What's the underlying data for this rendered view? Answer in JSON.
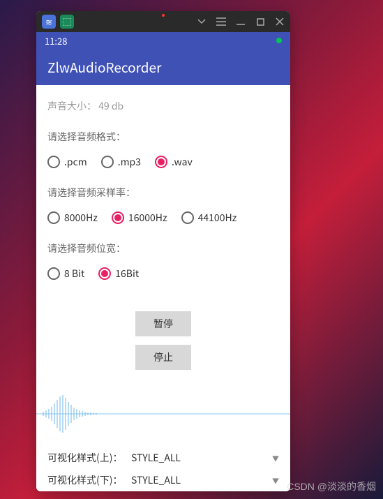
{
  "titlebar": {
    "icon1": "≋",
    "icon2": "⬚"
  },
  "statusbar": {
    "time": "11:28"
  },
  "appbar": {
    "title": "ZlwAudioRecorder"
  },
  "volume": {
    "label": "声音大小：",
    "value": "49 db"
  },
  "format": {
    "label": "请选择音频格式：",
    "options": [
      {
        "label": ".pcm",
        "selected": false
      },
      {
        "label": ".mp3",
        "selected": false
      },
      {
        "label": ".wav",
        "selected": true
      }
    ]
  },
  "sampleRate": {
    "label": "请选择音频采样率：",
    "options": [
      {
        "label": "8000Hz",
        "selected": false
      },
      {
        "label": "16000Hz",
        "selected": true
      },
      {
        "label": "44100Hz",
        "selected": false
      }
    ]
  },
  "bitWidth": {
    "label": "请选择音频位宽：",
    "options": [
      {
        "label": "8 Bit",
        "selected": false
      },
      {
        "label": "16Bit",
        "selected": true
      }
    ]
  },
  "buttons": {
    "pause": "暂停",
    "stop": "停止"
  },
  "spinners": {
    "top": {
      "label": "可视化样式(上)：",
      "value": "STYLE_ALL"
    },
    "bottom": {
      "label": "可视化样式(下)：",
      "value": "STYLE_ALL"
    }
  },
  "watermark": "CSDN @淡淡的香烟"
}
